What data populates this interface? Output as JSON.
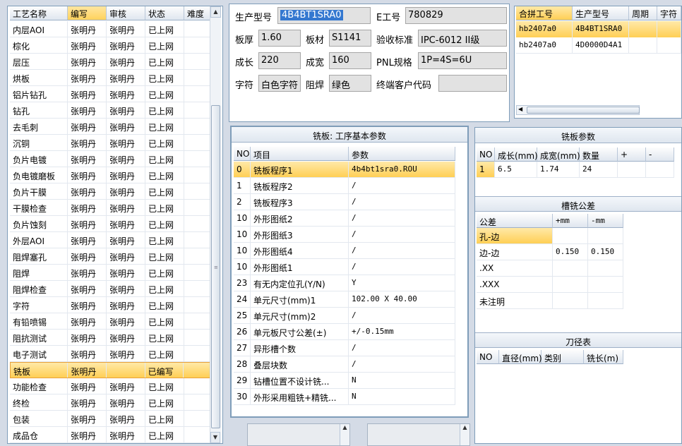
{
  "process": {
    "headers": [
      "工艺名称",
      "编写",
      "审核",
      "状态",
      "难度"
    ],
    "rows": [
      [
        "内层AOI",
        "张明丹",
        "张明丹",
        "已上网",
        ""
      ],
      [
        "棕化",
        "张明丹",
        "张明丹",
        "已上网",
        ""
      ],
      [
        "层压",
        "张明丹",
        "张明丹",
        "已上网",
        ""
      ],
      [
        "烘板",
        "张明丹",
        "张明丹",
        "已上网",
        ""
      ],
      [
        "铝片钻孔",
        "张明丹",
        "张明丹",
        "已上网",
        ""
      ],
      [
        "钻孔",
        "张明丹",
        "张明丹",
        "已上网",
        ""
      ],
      [
        "去毛刺",
        "张明丹",
        "张明丹",
        "已上网",
        ""
      ],
      [
        "沉铜",
        "张明丹",
        "张明丹",
        "已上网",
        ""
      ],
      [
        "负片电镀",
        "张明丹",
        "张明丹",
        "已上网",
        ""
      ],
      [
        "负电镀磨板",
        "张明丹",
        "张明丹",
        "已上网",
        ""
      ],
      [
        "负片干膜",
        "张明丹",
        "张明丹",
        "已上网",
        ""
      ],
      [
        "干膜检查",
        "张明丹",
        "张明丹",
        "已上网",
        ""
      ],
      [
        "负片蚀刻",
        "张明丹",
        "张明丹",
        "已上网",
        ""
      ],
      [
        "外层AOI",
        "张明丹",
        "张明丹",
        "已上网",
        ""
      ],
      [
        "阻焊塞孔",
        "张明丹",
        "张明丹",
        "已上网",
        ""
      ],
      [
        "阻焊",
        "张明丹",
        "张明丹",
        "已上网",
        ""
      ],
      [
        "阻焊检查",
        "张明丹",
        "张明丹",
        "已上网",
        ""
      ],
      [
        "字符",
        "张明丹",
        "张明丹",
        "已上网",
        ""
      ],
      [
        "有铅喷锡",
        "张明丹",
        "张明丹",
        "已上网",
        ""
      ],
      [
        "阻抗测试",
        "张明丹",
        "张明丹",
        "已上网",
        ""
      ],
      [
        "电子测试",
        "张明丹",
        "张明丹",
        "已上网",
        ""
      ],
      [
        "铣板",
        "张明丹",
        "",
        "已编写",
        ""
      ],
      [
        "功能检查",
        "张明丹",
        "张明丹",
        "已上网",
        ""
      ],
      [
        "终检",
        "张明丹",
        "张明丹",
        "已上网",
        ""
      ],
      [
        "包装",
        "张明丹",
        "张明丹",
        "已上网",
        ""
      ],
      [
        "成品仓",
        "张明丹",
        "张明丹",
        "已上网",
        ""
      ]
    ],
    "selected_index": 21
  },
  "info": {
    "model_label": "生产型号",
    "model_value": "4B4BT1SRA0",
    "eno_label": "E工号",
    "eno_value": "780829",
    "thick_label": "板厚",
    "thick_value": "1.60",
    "material_label": "板材",
    "material_value": "S1141",
    "std_label": "验收标准",
    "std_value": "IPC-6012 II级",
    "len_label": "成长",
    "len_value": "220",
    "wid_label": "成宽",
    "wid_value": "160",
    "pnl_label": "PNL规格",
    "pnl_value": "1P=4S=6U",
    "char_label": "字符",
    "char_value": "白色字符",
    "mask_label": "阻焊",
    "mask_value": "绿色",
    "cust_label": "终端客户代码",
    "cust_value": ""
  },
  "merge": {
    "headers": [
      "合拼工号",
      "生产型号",
      "周期",
      "字符"
    ],
    "rows": [
      [
        "hb2407a0",
        "4B4BT1SRA0",
        "",
        ""
      ],
      [
        "hb2407a0",
        "4D0000D4A1",
        "",
        ""
      ]
    ]
  },
  "mill": {
    "title": "铣板: 工序基本参数",
    "headers": [
      "NO",
      "项目",
      "参数"
    ],
    "rows": [
      [
        "0",
        "铣板程序1",
        "4b4bt1sra0.ROU"
      ],
      [
        "1",
        "铣板程序2",
        "/"
      ],
      [
        "2",
        "铣板程序3",
        "/"
      ],
      [
        "10",
        "外形图纸2",
        "/"
      ],
      [
        "10",
        "外形图纸3",
        "/"
      ],
      [
        "10",
        "外形图纸4",
        "/"
      ],
      [
        "10",
        "外形图纸1",
        "/"
      ],
      [
        "23",
        "有无内定位孔(Y/N)",
        "Y"
      ],
      [
        "24",
        "单元尺寸(mm)1",
        "102.00 X 40.00"
      ],
      [
        "25",
        "单元尺寸(mm)2",
        "/"
      ],
      [
        "26",
        "单元板尺寸公差(±)",
        "+/-0.15mm"
      ],
      [
        "27",
        "异形槽个数",
        "/"
      ],
      [
        "28",
        "叠层块数",
        "/"
      ],
      [
        "29",
        "钻槽位置不设计铣...",
        "N"
      ],
      [
        "30",
        "外形采用粗铣+精铣...",
        "N"
      ]
    ]
  },
  "millparams": {
    "title": "铣板参数",
    "headers": [
      "NO",
      "成长(mm)",
      "成宽(mm)",
      "数量",
      "+",
      "-"
    ],
    "row": [
      "1",
      "6.5",
      "1.74",
      "24",
      "",
      ""
    ]
  },
  "tolerance": {
    "title": "槽铣公差",
    "headers": [
      "公差",
      "+mm",
      "-mm"
    ],
    "rows": [
      [
        "孔-边",
        "",
        ""
      ],
      [
        "边-边",
        "0.150",
        "0.150"
      ],
      [
        ".XX",
        "",
        ""
      ],
      [
        ".XXX",
        "",
        ""
      ],
      [
        "未注明",
        "",
        ""
      ]
    ]
  },
  "cutter": {
    "title": "刀径表",
    "headers": [
      "NO",
      "直径(mm)",
      "类别",
      "铣长(m)"
    ]
  }
}
